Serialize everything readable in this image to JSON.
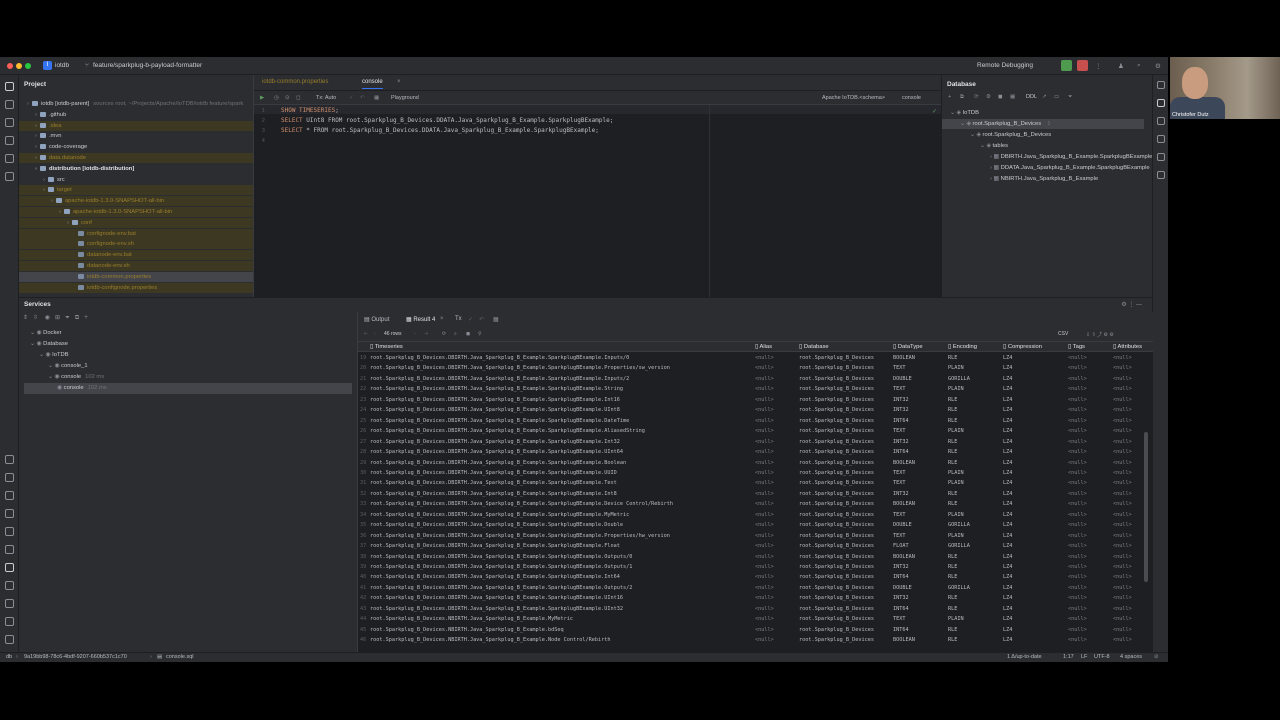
{
  "titlebar": {
    "project_badge": "I",
    "project": "iotdb",
    "branch": "feature/sparkplug-b-payload-formatter",
    "run_config": "Remote Debugging"
  },
  "project_panel": {
    "title": "Project",
    "items": [
      {
        "label": "iotdb [iotdb-parent]",
        "suffix": "sources root, ~/Projects/Apache/IoTDB/iotdb feature/spark",
        "level": 0,
        "style": "normal"
      },
      {
        "label": ".github",
        "level": 1,
        "style": "normal"
      },
      {
        "label": ".idea",
        "level": 1,
        "style": "excluded"
      },
      {
        "label": ".mvn",
        "level": 1,
        "style": "normal"
      },
      {
        "label": "code-coverage",
        "level": 1,
        "style": "normal"
      },
      {
        "label": "data.datanode",
        "level": 1,
        "style": "excluded"
      },
      {
        "label": "distribution [iotdb-distribution]",
        "level": 1,
        "style": "bold"
      },
      {
        "label": "src",
        "level": 2,
        "style": "normal"
      },
      {
        "label": "target",
        "level": 2,
        "style": "excluded"
      },
      {
        "label": "apache-iotdb-1.3.0-SNAPSHOT-all-bin",
        "level": 3,
        "style": "excluded"
      },
      {
        "label": "apache-iotdb-1.3.0-SNAPSHOT-all-bin",
        "level": 4,
        "style": "excluded"
      },
      {
        "label": "conf",
        "level": 5,
        "style": "excluded"
      },
      {
        "label": "confignode-env.bat",
        "level": 6,
        "style": "excluded"
      },
      {
        "label": "confignode-env.sh",
        "level": 6,
        "style": "excluded"
      },
      {
        "label": "datanode-env.bat",
        "level": 6,
        "style": "excluded"
      },
      {
        "label": "datanode-env.sh",
        "level": 6,
        "style": "excluded"
      },
      {
        "label": "iotdb-common.properties",
        "level": 6,
        "style": "selected"
      },
      {
        "label": "iotdb-confignode.properties",
        "level": 6,
        "style": "excluded"
      }
    ]
  },
  "editor": {
    "tabs": [
      "iotdb-common.properties",
      "console"
    ],
    "tx": "Tx: Auto",
    "playground": "Playground",
    "schema": "Apache IoTDB.<schema>",
    "console_sel": "console",
    "lines": [
      {
        "n": "1",
        "kw": "SHOW TIMESERIES",
        "rest": ";"
      },
      {
        "n": "2",
        "kw": "SELECT",
        "rest": " UInt8 FROM root.Sparkplug_B_Devices.DDATA.Java_Sparkplug_B_Example.SparkplugBExample;"
      },
      {
        "n": "3",
        "kw": "SELECT",
        "rest": " * FROM root.Sparkplug_B_Devices.DDATA.Java_Sparkplug_B_Example.SparkplugBExample;"
      },
      {
        "n": "4",
        "kw": "",
        "rest": ""
      }
    ]
  },
  "db_panel": {
    "title": "Database",
    "ddl": "DDL",
    "items": [
      {
        "label": "IoTDB",
        "level": 0
      },
      {
        "label": "root.Sparkplug_B_Devices",
        "level": 1,
        "count": "1",
        "selected": true
      },
      {
        "label": "root.Sparkplug_B_Devices",
        "level": 2
      },
      {
        "label": "tables",
        "level": 3
      },
      {
        "label": "DBIRTH.Java_Sparkplug_B_Example.SparkplugBExample",
        "level": 4
      },
      {
        "label": "DDATA.Java_Sparkplug_B_Example.SparkplugBExample",
        "level": 4
      },
      {
        "label": "NBIRTH.Java_Sparkplug_B_Example",
        "level": 4
      }
    ]
  },
  "services": {
    "title": "Services",
    "tree": [
      {
        "label": "Docker",
        "level": 0
      },
      {
        "label": "Database",
        "level": 0
      },
      {
        "label": "IoTDB",
        "level": 1
      },
      {
        "label": "console_1",
        "level": 2
      },
      {
        "label": "console",
        "suffix": "102 ms",
        "level": 2
      },
      {
        "label": "console",
        "suffix": "102 ms",
        "level": 3,
        "selected": true
      }
    ],
    "tabs": {
      "output": "Output",
      "result": "Result 4",
      "tx": "Tx"
    },
    "rows_label": "46 rows",
    "export": "CSV",
    "columns": [
      "Timeseries",
      "Alias",
      "Database",
      "DataType",
      "Encoding",
      "Compression",
      "Tags",
      "Attributes"
    ],
    "rows": [
      [
        "19",
        "root.Sparkplug_B_Devices.DBIRTH.Java_Sparkplug_B_Example.SparkplugBExample.Inputs/0",
        "<null>",
        "root.Sparkplug_B_Devices",
        "BOOLEAN",
        "RLE",
        "LZ4",
        "<null>",
        "<null>"
      ],
      [
        "20",
        "root.Sparkplug_B_Devices.DBIRTH.Java_Sparkplug_B_Example.SparkplugBExample.Properties/sw_version",
        "<null>",
        "root.Sparkplug_B_Devices",
        "TEXT",
        "PLAIN",
        "LZ4",
        "<null>",
        "<null>"
      ],
      [
        "21",
        "root.Sparkplug_B_Devices.DBIRTH.Java_Sparkplug_B_Example.SparkplugBExample.Inputs/2",
        "<null>",
        "root.Sparkplug_B_Devices",
        "DOUBLE",
        "GORILLA",
        "LZ4",
        "<null>",
        "<null>"
      ],
      [
        "22",
        "root.Sparkplug_B_Devices.DBIRTH.Java_Sparkplug_B_Example.SparkplugBExample.String",
        "<null>",
        "root.Sparkplug_B_Devices",
        "TEXT",
        "PLAIN",
        "LZ4",
        "<null>",
        "<null>"
      ],
      [
        "23",
        "root.Sparkplug_B_Devices.DBIRTH.Java_Sparkplug_B_Example.SparkplugBExample.Int16",
        "<null>",
        "root.Sparkplug_B_Devices",
        "INT32",
        "RLE",
        "LZ4",
        "<null>",
        "<null>"
      ],
      [
        "24",
        "root.Sparkplug_B_Devices.DBIRTH.Java_Sparkplug_B_Example.SparkplugBExample.UInt8",
        "<null>",
        "root.Sparkplug_B_Devices",
        "INT32",
        "RLE",
        "LZ4",
        "<null>",
        "<null>"
      ],
      [
        "25",
        "root.Sparkplug_B_Devices.DBIRTH.Java_Sparkplug_B_Example.SparkplugBExample.DateTime",
        "<null>",
        "root.Sparkplug_B_Devices",
        "INT64",
        "RLE",
        "LZ4",
        "<null>",
        "<null>"
      ],
      [
        "26",
        "root.Sparkplug_B_Devices.DBIRTH.Java_Sparkplug_B_Example.SparkplugBExample.AliasedString",
        "<null>",
        "root.Sparkplug_B_Devices",
        "TEXT",
        "PLAIN",
        "LZ4",
        "<null>",
        "<null>"
      ],
      [
        "27",
        "root.Sparkplug_B_Devices.DBIRTH.Java_Sparkplug_B_Example.SparkplugBExample.Int32",
        "<null>",
        "root.Sparkplug_B_Devices",
        "INT32",
        "RLE",
        "LZ4",
        "<null>",
        "<null>"
      ],
      [
        "28",
        "root.Sparkplug_B_Devices.DBIRTH.Java_Sparkplug_B_Example.SparkplugBExample.UInt64",
        "<null>",
        "root.Sparkplug_B_Devices",
        "INT64",
        "RLE",
        "LZ4",
        "<null>",
        "<null>"
      ],
      [
        "29",
        "root.Sparkplug_B_Devices.DBIRTH.Java_Sparkplug_B_Example.SparkplugBExample.Boolean",
        "<null>",
        "root.Sparkplug_B_Devices",
        "BOOLEAN",
        "RLE",
        "LZ4",
        "<null>",
        "<null>"
      ],
      [
        "30",
        "root.Sparkplug_B_Devices.DBIRTH.Java_Sparkplug_B_Example.SparkplugBExample.UUID",
        "<null>",
        "root.Sparkplug_B_Devices",
        "TEXT",
        "PLAIN",
        "LZ4",
        "<null>",
        "<null>"
      ],
      [
        "31",
        "root.Sparkplug_B_Devices.DBIRTH.Java_Sparkplug_B_Example.SparkplugBExample.Text",
        "<null>",
        "root.Sparkplug_B_Devices",
        "TEXT",
        "PLAIN",
        "LZ4",
        "<null>",
        "<null>"
      ],
      [
        "32",
        "root.Sparkplug_B_Devices.DBIRTH.Java_Sparkplug_B_Example.SparkplugBExample.Int8",
        "<null>",
        "root.Sparkplug_B_Devices",
        "INT32",
        "RLE",
        "LZ4",
        "<null>",
        "<null>"
      ],
      [
        "33",
        "root.Sparkplug_B_Devices.DBIRTH.Java_Sparkplug_B_Example.SparkplugBExample.Device Control/Rebirth",
        "<null>",
        "root.Sparkplug_B_Devices",
        "BOOLEAN",
        "RLE",
        "LZ4",
        "<null>",
        "<null>"
      ],
      [
        "34",
        "root.Sparkplug_B_Devices.DBIRTH.Java_Sparkplug_B_Example.SparkplugBExample.MyMetric",
        "<null>",
        "root.Sparkplug_B_Devices",
        "TEXT",
        "PLAIN",
        "LZ4",
        "<null>",
        "<null>"
      ],
      [
        "35",
        "root.Sparkplug_B_Devices.DBIRTH.Java_Sparkplug_B_Example.SparkplugBExample.Double",
        "<null>",
        "root.Sparkplug_B_Devices",
        "DOUBLE",
        "GORILLA",
        "LZ4",
        "<null>",
        "<null>"
      ],
      [
        "36",
        "root.Sparkplug_B_Devices.DBIRTH.Java_Sparkplug_B_Example.SparkplugBExample.Properties/hw_version",
        "<null>",
        "root.Sparkplug_B_Devices",
        "TEXT",
        "PLAIN",
        "LZ4",
        "<null>",
        "<null>"
      ],
      [
        "37",
        "root.Sparkplug_B_Devices.DBIRTH.Java_Sparkplug_B_Example.SparkplugBExample.Float",
        "<null>",
        "root.Sparkplug_B_Devices",
        "FLOAT",
        "GORILLA",
        "LZ4",
        "<null>",
        "<null>"
      ],
      [
        "38",
        "root.Sparkplug_B_Devices.DBIRTH.Java_Sparkplug_B_Example.SparkplugBExample.Outputs/0",
        "<null>",
        "root.Sparkplug_B_Devices",
        "BOOLEAN",
        "RLE",
        "LZ4",
        "<null>",
        "<null>"
      ],
      [
        "39",
        "root.Sparkplug_B_Devices.DBIRTH.Java_Sparkplug_B_Example.SparkplugBExample.Outputs/1",
        "<null>",
        "root.Sparkplug_B_Devices",
        "INT32",
        "RLE",
        "LZ4",
        "<null>",
        "<null>"
      ],
      [
        "40",
        "root.Sparkplug_B_Devices.DBIRTH.Java_Sparkplug_B_Example.SparkplugBExample.Int64",
        "<null>",
        "root.Sparkplug_B_Devices",
        "INT64",
        "RLE",
        "LZ4",
        "<null>",
        "<null>"
      ],
      [
        "41",
        "root.Sparkplug_B_Devices.DBIRTH.Java_Sparkplug_B_Example.SparkplugBExample.Outputs/2",
        "<null>",
        "root.Sparkplug_B_Devices",
        "DOUBLE",
        "GORILLA",
        "LZ4",
        "<null>",
        "<null>"
      ],
      [
        "42",
        "root.Sparkplug_B_Devices.DBIRTH.Java_Sparkplug_B_Example.SparkplugBExample.UInt16",
        "<null>",
        "root.Sparkplug_B_Devices",
        "INT32",
        "RLE",
        "LZ4",
        "<null>",
        "<null>"
      ],
      [
        "43",
        "root.Sparkplug_B_Devices.DBIRTH.Java_Sparkplug_B_Example.SparkplugBExample.UInt32",
        "<null>",
        "root.Sparkplug_B_Devices",
        "INT64",
        "RLE",
        "LZ4",
        "<null>",
        "<null>"
      ],
      [
        "44",
        "root.Sparkplug_B_Devices.NBIRTH.Java_Sparkplug_B_Example.MyMetric",
        "<null>",
        "root.Sparkplug_B_Devices",
        "TEXT",
        "PLAIN",
        "LZ4",
        "<null>",
        "<null>"
      ],
      [
        "45",
        "root.Sparkplug_B_Devices.NBIRTH.Java_Sparkplug_B_Example.bdSeq",
        "<null>",
        "root.Sparkplug_B_Devices",
        "INT64",
        "RLE",
        "LZ4",
        "<null>",
        "<null>"
      ],
      [
        "46",
        "root.Sparkplug_B_Devices.NBIRTH.Java_Sparkplug_B_Example.Node Control/Rebirth",
        "<null>",
        "root.Sparkplug_B_Devices",
        "BOOLEAN",
        "RLE",
        "LZ4",
        "<null>",
        "<null>"
      ]
    ]
  },
  "statusbar": {
    "hash": "9a19bb98-78c6-4bdf-9207-660b537c1c70",
    "file": "console.sql",
    "vcs": "1 Δ/up-to-date",
    "pos": "1:17",
    "lf": "LF",
    "enc": "UTF-8",
    "indent": "4 spaces",
    "root": "db"
  },
  "webcam": {
    "name": "Christofer Dutz"
  },
  "colors": {
    "accent": "#3574f0",
    "excluded": "#9a7e2c",
    "keyword": "#cf8e6d"
  }
}
